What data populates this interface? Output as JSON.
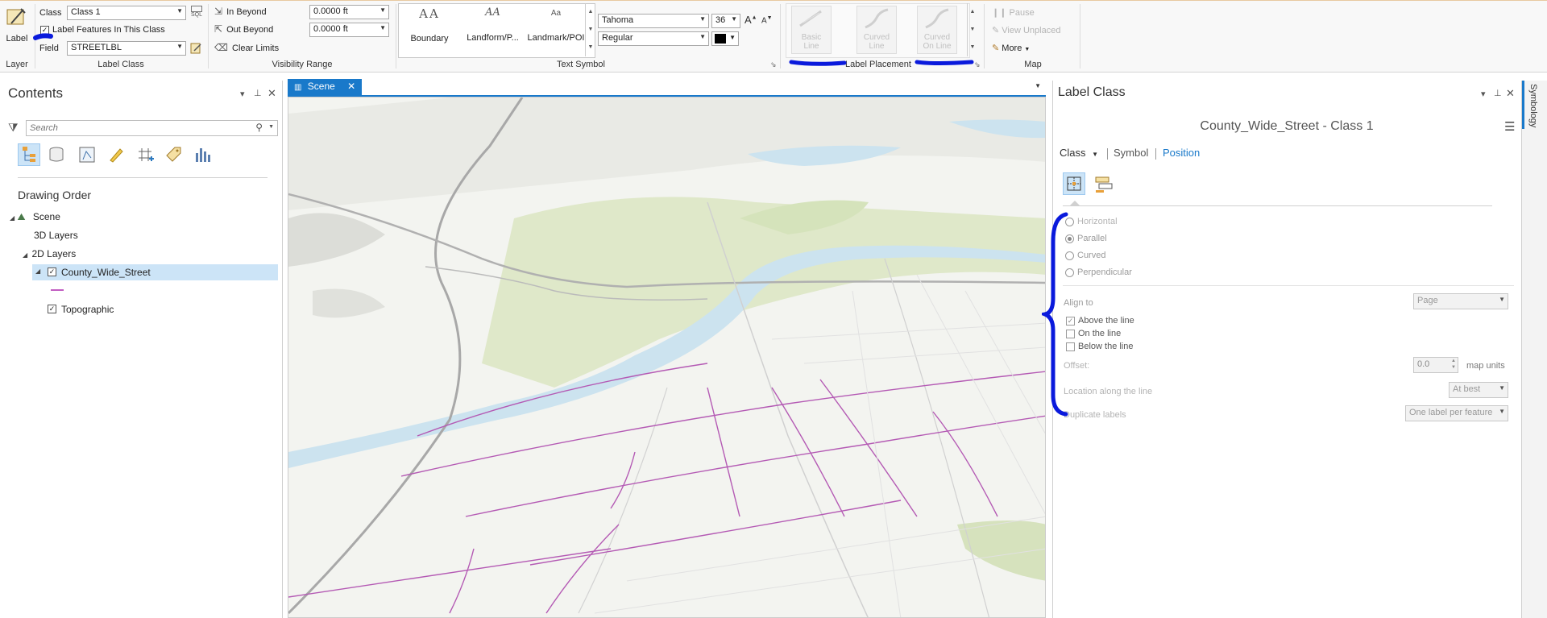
{
  "ribbon": {
    "layer": {
      "label_button": "Label",
      "group_title": "Layer"
    },
    "label_class": {
      "class_label": "Class",
      "class_value": "Class 1",
      "sql_label": "SQL",
      "label_features_checkbox": "Label Features In This Class",
      "field_label": "Field",
      "field_value": "STREETLBL",
      "group_title": "Label Class"
    },
    "visibility_range": {
      "in_beyond": "In Beyond",
      "out_beyond": "Out Beyond",
      "clear_limits": "Clear Limits",
      "in_value": "0.0000 ft",
      "out_value": "0.0000 ft",
      "group_title": "Visibility Range"
    },
    "text_symbol": {
      "gallery": [
        {
          "preview": "AA",
          "label": "Boundary"
        },
        {
          "preview": "AA",
          "label": "Landform/P..."
        },
        {
          "preview": "Aa",
          "label": "Landmark/POI"
        }
      ],
      "font_name": "Tahoma",
      "font_size": "36",
      "font_style": "Regular",
      "grow_icon": "A",
      "shrink_icon": "A",
      "group_title": "Text Symbol"
    },
    "label_placement": {
      "items": [
        {
          "label": "Basic Line"
        },
        {
          "label": "Curved Line"
        },
        {
          "label": "Curved On Line"
        }
      ],
      "group_title": "Label Placement"
    },
    "map": {
      "pause": "Pause",
      "view_unplaced": "View Unplaced",
      "more": "More",
      "group_title": "Map"
    }
  },
  "contents": {
    "title": "Contents",
    "search_placeholder": "Search",
    "section_title": "Drawing Order",
    "tree": [
      {
        "label": "Scene"
      },
      {
        "label": "3D Layers"
      },
      {
        "label": "2D Layers"
      },
      {
        "label": "County_Wide_Street"
      },
      {
        "label": "Topographic"
      }
    ]
  },
  "map": {
    "tab_label": "Scene"
  },
  "label_class_pane": {
    "title": "Label Class",
    "subtitle": "County_Wide_Street - Class 1",
    "tabs": {
      "class": "Class",
      "symbol": "Symbol",
      "position": "Position"
    },
    "orientation_options": [
      "Horizontal",
      "Parallel",
      "Curved",
      "Perpendicular"
    ],
    "selected_orientation": "Parallel",
    "align_to_label": "Align to",
    "align_to_value": "Page",
    "position_options": [
      "Above the line",
      "On the line",
      "Below the line"
    ],
    "offset_label": "Offset:",
    "offset_value": "0.0",
    "offset_units": "map units",
    "location_label": "Location along the line",
    "location_value": "At best",
    "duplicate_label": "Duplicate labels",
    "duplicate_value": "One label per feature"
  },
  "side_tab": {
    "label": "Symbology"
  },
  "colors": {
    "accent": "#1979ca",
    "annotation": "#0a1adc",
    "street": "#b45ab4"
  }
}
